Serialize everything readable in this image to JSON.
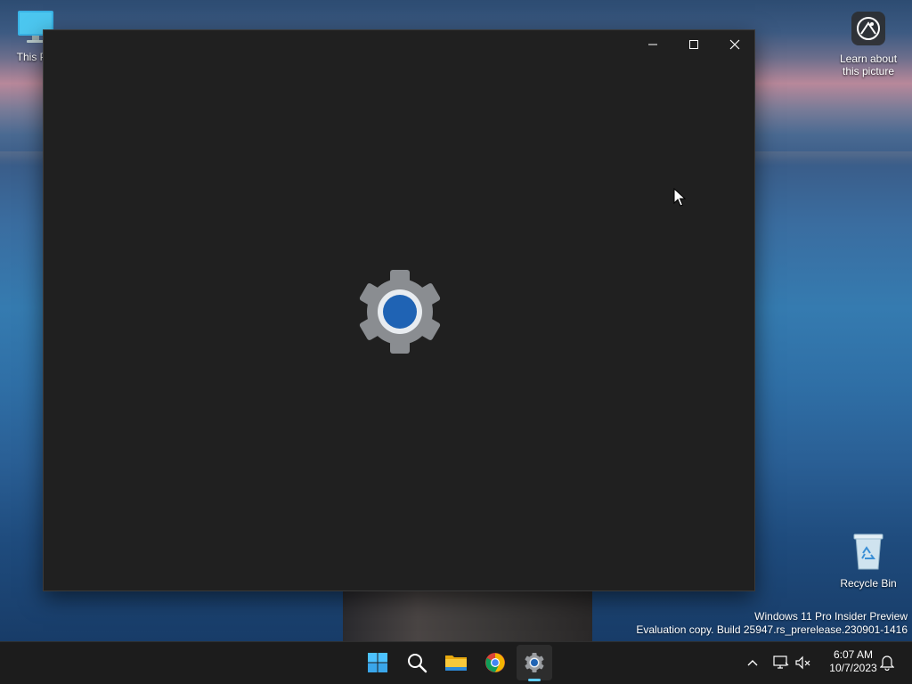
{
  "desktop": {
    "icons": {
      "this_pc": {
        "label": "This PC"
      },
      "learn": {
        "label_line1": "Learn about",
        "label_line2": "this picture"
      },
      "recycle_bin": {
        "label": "Recycle Bin"
      }
    },
    "watermark": {
      "line1": "Windows 11 Pro Insider Preview",
      "line2": "Evaluation copy. Build 25947.rs_prerelease.230901-1416"
    }
  },
  "window": {
    "app": "Settings",
    "state": "loading-splash",
    "controls": {
      "minimize_icon": "minimize-icon",
      "maximize_icon": "maximize-icon",
      "close_icon": "close-icon"
    },
    "colors": {
      "background": "#202020",
      "gear_gray": "#8a8d91",
      "gear_accent": "#1f63b4"
    }
  },
  "taskbar": {
    "apps": [
      {
        "name": "Start",
        "icon": "windows-start-icon"
      },
      {
        "name": "Search",
        "icon": "search-icon"
      },
      {
        "name": "File Explorer",
        "icon": "folder-icon"
      },
      {
        "name": "Google Chrome",
        "icon": "chrome-icon"
      },
      {
        "name": "Settings",
        "icon": "gear-icon",
        "active": true
      }
    ],
    "tray": {
      "time": "6:07 AM",
      "date": "10/7/2023"
    },
    "accent": "#60cdff"
  }
}
